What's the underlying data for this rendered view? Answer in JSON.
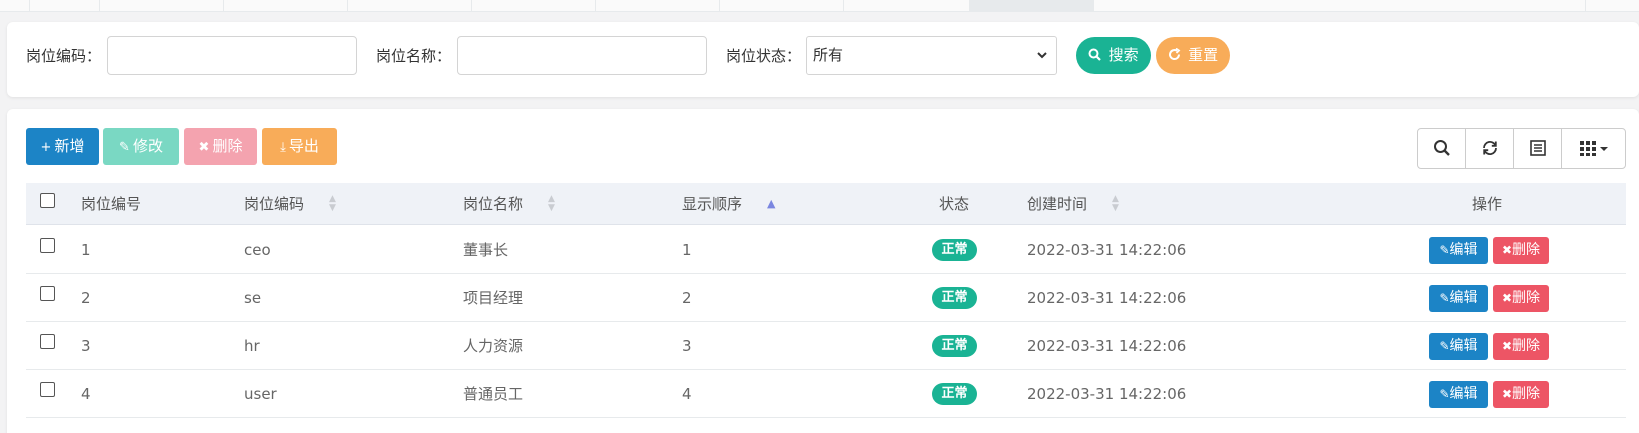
{
  "search": {
    "post_code_label": "岗位编码：",
    "post_code_value": "",
    "post_name_label": "岗位名称：",
    "post_name_value": "",
    "post_status_label": "岗位状态：",
    "post_status_selected": "所有",
    "search_icon": "search-icon",
    "search_label": "搜索",
    "reset_icon": "refresh-icon",
    "reset_label": "重置"
  },
  "toolbar": {
    "add_icon": "+",
    "add_label": "新增",
    "edit_icon": "✎",
    "edit_label": "修改",
    "delete_icon": "✖",
    "delete_label": "删除",
    "export_icon": "⤓",
    "export_label": "导出",
    "tools": [
      "search-icon",
      "refresh-icon",
      "list-view-icon",
      "columns-grid-icon"
    ]
  },
  "table": {
    "columns": [
      "岗位编号",
      "岗位编码",
      "岗位名称",
      "显示顺序",
      "状态",
      "创建时间",
      "操作"
    ],
    "rows": [
      {
        "id": "1",
        "code": "ceo",
        "name": "董事长",
        "order": "1",
        "status": "正常",
        "created": "2022-03-31 14:22:06"
      },
      {
        "id": "2",
        "code": "se",
        "name": "项目经理",
        "order": "2",
        "status": "正常",
        "created": "2022-03-31 14:22:06"
      },
      {
        "id": "3",
        "code": "hr",
        "name": "人力资源",
        "order": "3",
        "status": "正常",
        "created": "2022-03-31 14:22:06"
      },
      {
        "id": "4",
        "code": "user",
        "name": "普通员工",
        "order": "4",
        "status": "正常",
        "created": "2022-03-31 14:22:06"
      }
    ],
    "row_edit_label": "编辑",
    "row_delete_label": "删除"
  },
  "colors": {
    "primary": "#1c84c6",
    "success": "#1ab394",
    "warning": "#f8ac59",
    "danger": "#ed5565"
  }
}
